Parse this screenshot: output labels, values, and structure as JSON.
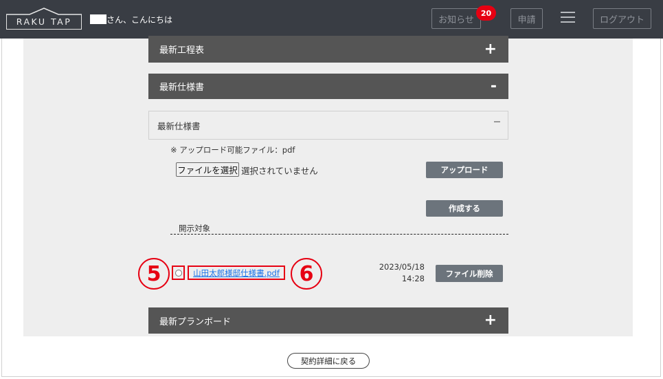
{
  "header": {
    "logo_text": "RAKU TAP",
    "greeting": "さん、こんにちは",
    "notifications_label": "お知らせ",
    "notifications_count": "20",
    "apply_label": "申請",
    "menu_icon": "hamburger-menu-icon",
    "logout_label": "ログアウト"
  },
  "sections": {
    "schedule": {
      "title": "最新工程表",
      "toggle": "+"
    },
    "spec": {
      "title": "最新仕様書",
      "toggle": "-"
    },
    "planboard": {
      "title": "最新プランボード",
      "toggle": "+"
    }
  },
  "spec_panel": {
    "title": "最新仕様書",
    "upload_note": "※ アップロード可能ファイル：pdf",
    "file_button": "ファイルを選択",
    "file_status": "選択されていません",
    "upload_button": "アップロード",
    "create_button": "作成する",
    "disclose_label": "開示対象",
    "files": [
      {
        "name": "山田太郎様邸仕様書.pdf",
        "date": "2023/05/18",
        "time": "14:28",
        "delete_label": "ファイル削除"
      }
    ]
  },
  "annotations": {
    "marker_5": "5",
    "marker_6": "6",
    "color": "#e60012"
  },
  "footer": {
    "back_label": "契約詳細に戻る"
  },
  "colors": {
    "header_bg": "#393d44",
    "section_bg": "#555555",
    "button_bg": "#6c747c",
    "badge_bg": "#e60012",
    "link": "#1a73e8"
  }
}
